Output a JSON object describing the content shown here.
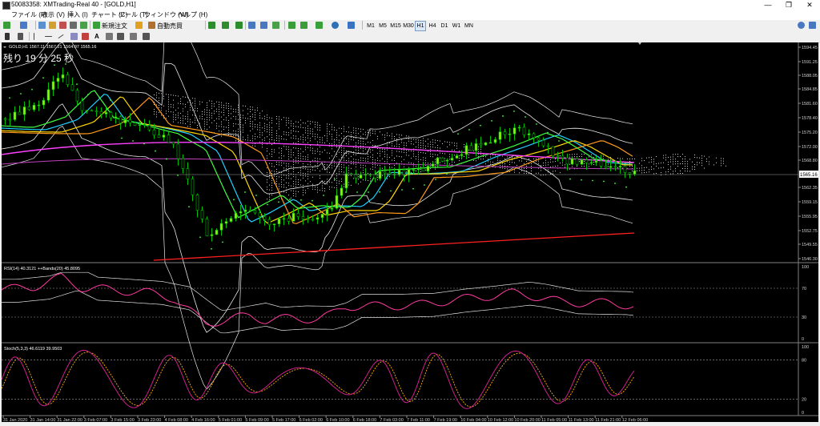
{
  "window": {
    "title": "50083358: XMTrading-Real 40 - [GOLD,H1]",
    "minimize": "—",
    "maximize": "❐",
    "close": "✕"
  },
  "menu": [
    "ファイル (F)",
    "表示 (V)",
    "挿入 (I)",
    "チャート (C)",
    "ツール (T)",
    "ウィンドウ (W)",
    "ヘルプ (H)"
  ],
  "toolbar": {
    "new_order": "新規注文",
    "auto_trading": "自動売買",
    "text_tool": "A",
    "timeframes": [
      "M1",
      "M5",
      "M15",
      "M30",
      "H1",
      "H4",
      "D1",
      "W1",
      "MN"
    ],
    "active_timeframe": "H1"
  },
  "chart": {
    "header": "GOLD,H1  1567.11 1567.21 1564.97 1565.16",
    "countdown": "残り 19 分 25 秒",
    "current_price": "1565.16",
    "price_labels": [
      "1594.45",
      "1591.25",
      "1588.05",
      "1584.85",
      "1581.60",
      "1578.40",
      "1575.20",
      "1572.00",
      "1568.80",
      "1562.35",
      "1559.15",
      "1555.95",
      "1552.75",
      "1549.55",
      "1546.30"
    ],
    "time_labels": [
      "31 Jan 2020",
      "31 Jan 14:00",
      "31 Jan 22:00",
      "3 Feb 07:00",
      "3 Feb 15:00",
      "3 Feb 23:00",
      "4 Feb 08:00",
      "4 Feb 16:00",
      "5 Feb 01:00",
      "5 Feb 09:00",
      "5 Feb 17:00",
      "6 Feb 02:00",
      "6 Feb 10:00",
      "6 Feb 18:00",
      "7 Feb 03:00",
      "7 Feb 11:00",
      "7 Feb 19:00",
      "10 Feb 04:00",
      "10 Feb 12:00",
      "10 Feb 20:00",
      "11 Feb 05:00",
      "11 Feb 13:00",
      "11 Feb 21:00",
      "12 Feb 06:00"
    ],
    "colors": {
      "background": "#000000",
      "bull": "#00c000",
      "bear": "#000000",
      "bull_body": "#7fff00",
      "red_trend": "#ff2020",
      "magenta": "#ff40ff",
      "cyan": "#20d0ff",
      "yellow": "#ffd700",
      "orange": "#ff9a1a",
      "green": "#40ff40",
      "white": "#e8e8e8"
    }
  },
  "rsi": {
    "header": "RSI(14) 40.3121  ++Bands(20) 45.8095",
    "levels": [
      "100",
      "70",
      "30",
      "0"
    ]
  },
  "stoch": {
    "header": "Stoch(5,3,3) 46.6119 39.9503",
    "levels": [
      "100",
      "80",
      "20",
      "0"
    ]
  }
}
